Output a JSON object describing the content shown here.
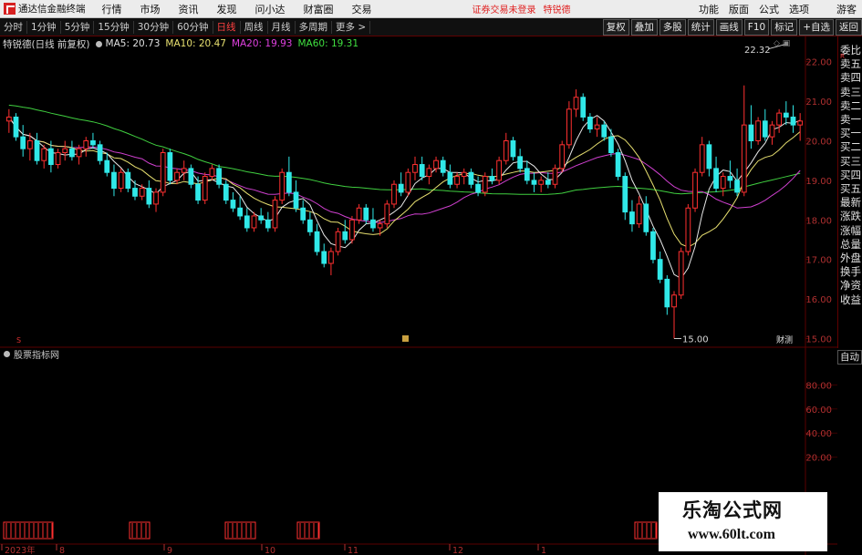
{
  "menubar": {
    "app_title": "通达信金融终端",
    "items": [
      "行情",
      "市场",
      "资讯",
      "发现",
      "问小达",
      "财富圈",
      "交易"
    ],
    "login_warning": "证券交易未登录",
    "login_name": "特锐德",
    "right_items": [
      "功能",
      "版面",
      "公式",
      "选项"
    ],
    "guest": "游客"
  },
  "toolbar": {
    "tabs": [
      "分时",
      "1分钟",
      "5分钟",
      "15分钟",
      "30分钟",
      "60分钟",
      "日线",
      "周线",
      "月线",
      "多周期",
      "更多 >"
    ],
    "active_tab": "日线",
    "right_buttons": [
      "复权",
      "叠加",
      "多股",
      "统计",
      "画线",
      "F10",
      "标记",
      "+自选",
      "返回"
    ]
  },
  "chart_header": {
    "stock": "特锐德(日线 前复权)",
    "ma5": "MA5: 20.73",
    "ma10": "MA10: 20.47",
    "ma20": "MA20: 19.93",
    "ma60": "MA60: 19.31"
  },
  "sidebar": {
    "items": [
      "委比",
      "卖五",
      "卖四",
      "卖三",
      "卖二",
      "卖一",
      "买一",
      "买二",
      "买三",
      "买四",
      "买五",
      "最新",
      "涨跌",
      "涨幅",
      "总量",
      "外盘",
      "换手",
      "净资",
      "收益"
    ]
  },
  "sub_panel": {
    "title": "股票指标网",
    "auto_label": "自动"
  },
  "finance_label": "财测",
  "x_axis": [
    "2023年",
    "8",
    "9",
    "10",
    "11",
    "12",
    "1"
  ],
  "annotations": {
    "high": "22.32",
    "low": "15.00"
  },
  "colors": {
    "up": "#ff3030",
    "down": "#30e8e8",
    "ma5": "#e8e8e8",
    "ma10": "#e8e070",
    "ma20": "#d040d0",
    "ma60": "#40d040",
    "grid": "#5a0000"
  },
  "watermark": {
    "title": "乐淘公式网",
    "url": "www.60lt.com"
  },
  "chart_data": [
    {
      "type": "candlestick",
      "title": "特锐德(日线 前复权)",
      "y_ticks": [
        "22.00",
        "21.00",
        "20.00",
        "19.00",
        "18.00",
        "17.00",
        "16.00",
        "15.00"
      ],
      "ylim": [
        14.85,
        22.5
      ],
      "candles": [
        [
          20.5,
          20.8,
          20.2,
          20.6
        ],
        [
          20.6,
          20.7,
          20.0,
          20.1
        ],
        [
          20.1,
          20.4,
          19.6,
          19.8
        ],
        [
          19.8,
          20.2,
          19.5,
          20.0
        ],
        [
          20.0,
          20.2,
          19.4,
          19.5
        ],
        [
          19.5,
          19.9,
          19.3,
          19.8
        ],
        [
          19.8,
          20.0,
          19.2,
          19.4
        ],
        [
          19.4,
          19.8,
          19.3,
          19.7
        ],
        [
          19.7,
          20.0,
          19.5,
          19.8
        ],
        [
          19.8,
          20.0,
          19.5,
          19.6
        ],
        [
          19.6,
          19.9,
          19.4,
          19.8
        ],
        [
          19.8,
          20.1,
          19.6,
          20.0
        ],
        [
          20.0,
          20.2,
          19.8,
          19.9
        ],
        [
          19.9,
          20.0,
          19.4,
          19.5
        ],
        [
          19.5,
          19.7,
          19.1,
          19.2
        ],
        [
          19.2,
          19.4,
          18.6,
          18.8
        ],
        [
          18.8,
          19.3,
          18.7,
          19.2
        ],
        [
          19.2,
          19.3,
          18.7,
          18.8
        ],
        [
          18.8,
          19.0,
          18.5,
          18.6
        ],
        [
          18.6,
          18.9,
          18.5,
          18.8
        ],
        [
          18.8,
          19.0,
          18.3,
          18.4
        ],
        [
          18.4,
          18.8,
          18.2,
          18.7
        ],
        [
          18.7,
          19.8,
          18.6,
          19.7
        ],
        [
          19.7,
          19.8,
          18.9,
          19.0
        ],
        [
          19.0,
          19.3,
          18.9,
          19.2
        ],
        [
          19.2,
          19.5,
          19.0,
          19.3
        ],
        [
          19.3,
          19.4,
          18.8,
          18.9
        ],
        [
          18.9,
          19.1,
          18.4,
          18.5
        ],
        [
          18.5,
          19.2,
          18.4,
          19.1
        ],
        [
          19.1,
          19.4,
          19.0,
          19.3
        ],
        [
          19.3,
          19.4,
          18.8,
          18.9
        ],
        [
          18.9,
          19.0,
          18.4,
          18.5
        ],
        [
          18.5,
          18.7,
          18.2,
          18.3
        ],
        [
          18.3,
          18.6,
          18.0,
          18.1
        ],
        [
          18.1,
          18.3,
          17.7,
          17.8
        ],
        [
          17.8,
          18.2,
          17.7,
          18.1
        ],
        [
          18.1,
          18.3,
          17.9,
          18.0
        ],
        [
          18.0,
          18.2,
          17.7,
          17.8
        ],
        [
          17.8,
          18.6,
          17.7,
          18.5
        ],
        [
          18.5,
          19.3,
          18.4,
          19.2
        ],
        [
          19.2,
          19.6,
          18.6,
          18.7
        ],
        [
          18.7,
          19.0,
          18.2,
          18.3
        ],
        [
          18.3,
          18.5,
          17.9,
          18.0
        ],
        [
          18.0,
          18.2,
          17.6,
          17.7
        ],
        [
          17.7,
          17.9,
          17.1,
          17.2
        ],
        [
          17.2,
          17.4,
          16.8,
          16.9
        ],
        [
          16.9,
          17.3,
          16.6,
          17.2
        ],
        [
          17.2,
          17.8,
          17.1,
          17.7
        ],
        [
          17.7,
          18.0,
          17.4,
          17.5
        ],
        [
          17.5,
          18.1,
          17.4,
          18.0
        ],
        [
          18.0,
          18.4,
          17.9,
          18.3
        ],
        [
          18.3,
          18.4,
          17.9,
          18.0
        ],
        [
          18.0,
          18.3,
          17.7,
          17.8
        ],
        [
          17.8,
          18.0,
          17.6,
          17.9
        ],
        [
          17.9,
          18.5,
          17.8,
          18.4
        ],
        [
          18.4,
          19.0,
          18.3,
          18.9
        ],
        [
          18.9,
          19.2,
          18.6,
          18.7
        ],
        [
          18.7,
          19.3,
          18.6,
          19.2
        ],
        [
          19.2,
          19.6,
          19.0,
          19.4
        ],
        [
          19.4,
          19.6,
          19.0,
          19.1
        ],
        [
          19.1,
          19.4,
          18.9,
          19.3
        ],
        [
          19.3,
          19.6,
          19.2,
          19.5
        ],
        [
          19.5,
          19.6,
          19.1,
          19.2
        ],
        [
          19.2,
          19.4,
          18.8,
          18.9
        ],
        [
          18.9,
          19.2,
          18.8,
          19.1
        ],
        [
          19.1,
          19.3,
          18.9,
          19.2
        ],
        [
          19.2,
          19.3,
          18.8,
          18.9
        ],
        [
          18.9,
          19.1,
          18.6,
          18.7
        ],
        [
          18.7,
          19.2,
          18.6,
          19.1
        ],
        [
          19.1,
          19.3,
          18.9,
          19.0
        ],
        [
          19.0,
          19.6,
          18.9,
          19.5
        ],
        [
          19.5,
          20.2,
          19.4,
          20.0
        ],
        [
          20.0,
          20.1,
          19.5,
          19.6
        ],
        [
          19.6,
          19.8,
          19.2,
          19.3
        ],
        [
          19.3,
          19.5,
          18.9,
          19.0
        ],
        [
          19.0,
          19.2,
          18.7,
          18.9
        ],
        [
          18.9,
          19.1,
          18.7,
          19.0
        ],
        [
          19.0,
          19.2,
          18.8,
          18.9
        ],
        [
          18.9,
          19.4,
          18.8,
          19.3
        ],
        [
          19.3,
          20.0,
          19.2,
          19.9
        ],
        [
          19.9,
          21.0,
          19.8,
          20.8
        ],
        [
          20.8,
          21.3,
          20.6,
          21.1
        ],
        [
          21.1,
          21.2,
          20.5,
          20.6
        ],
        [
          20.6,
          20.7,
          20.2,
          20.3
        ],
        [
          20.3,
          20.6,
          20.1,
          20.4
        ],
        [
          20.4,
          20.5,
          20.0,
          20.1
        ],
        [
          20.1,
          20.3,
          19.6,
          19.7
        ],
        [
          19.7,
          19.8,
          19.0,
          19.1
        ],
        [
          19.1,
          19.2,
          18.0,
          18.2
        ],
        [
          18.2,
          18.5,
          17.7,
          17.9
        ],
        [
          17.9,
          18.6,
          17.8,
          18.4
        ],
        [
          18.4,
          18.6,
          17.6,
          17.7
        ],
        [
          17.7,
          17.8,
          16.9,
          17.0
        ],
        [
          17.0,
          17.2,
          16.4,
          16.5
        ],
        [
          16.5,
          16.6,
          15.6,
          15.8
        ],
        [
          15.8,
          16.2,
          15.0,
          16.1
        ],
        [
          16.1,
          17.3,
          16.0,
          17.2
        ],
        [
          17.2,
          18.4,
          17.1,
          18.3
        ],
        [
          18.3,
          19.3,
          18.2,
          19.2
        ],
        [
          19.2,
          20.1,
          19.1,
          19.9
        ],
        [
          19.9,
          20.0,
          19.1,
          19.3
        ],
        [
          19.3,
          19.6,
          18.7,
          18.8
        ],
        [
          18.8,
          19.2,
          18.6,
          19.1
        ],
        [
          19.1,
          19.5,
          18.8,
          19.0
        ],
        [
          19.0,
          19.3,
          18.6,
          18.7
        ],
        [
          18.7,
          21.4,
          18.6,
          20.4
        ],
        [
          20.4,
          20.9,
          19.8,
          20.0
        ],
        [
          20.0,
          20.6,
          19.9,
          20.5
        ],
        [
          20.5,
          20.8,
          20.0,
          20.1
        ],
        [
          20.1,
          20.5,
          19.9,
          20.4
        ],
        [
          20.4,
          20.8,
          20.2,
          20.7
        ],
        [
          20.7,
          21.0,
          20.4,
          20.6
        ],
        [
          20.6,
          20.9,
          20.2,
          20.4
        ],
        [
          20.4,
          20.7,
          20.0,
          20.5
        ]
      ],
      "moving_averages": [
        {
          "name": "MA5",
          "last": 20.73
        },
        {
          "name": "MA10",
          "last": 20.47
        },
        {
          "name": "MA20",
          "last": 19.93
        },
        {
          "name": "MA60",
          "last": 19.31
        }
      ]
    },
    {
      "type": "line",
      "title": "股票指标网",
      "y_ticks": [
        "80.00",
        "60.00",
        "40.00",
        "20.00"
      ],
      "ylim": [
        0,
        100
      ],
      "series": []
    }
  ]
}
